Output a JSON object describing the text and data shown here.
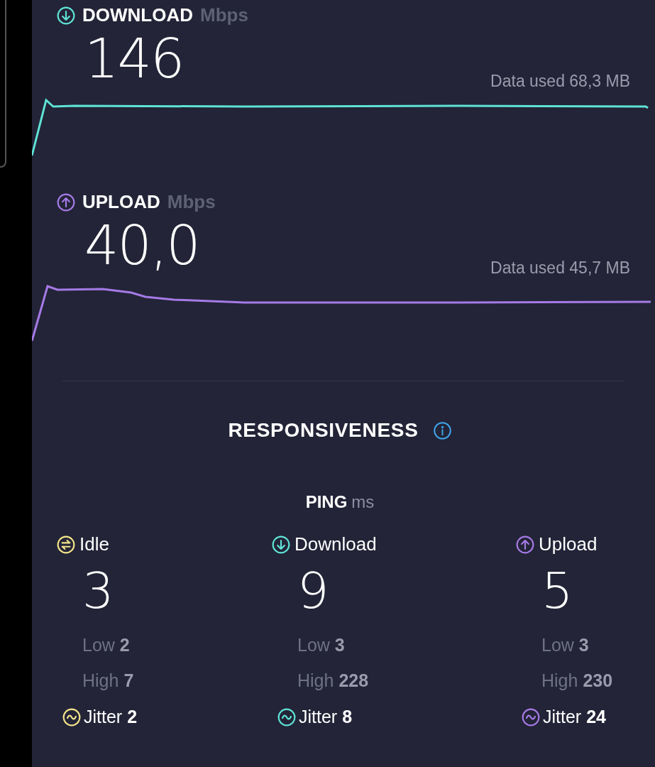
{
  "speeds": [
    {
      "kind": "download",
      "label": "DOWNLOAD",
      "unit": "Mbps",
      "value": "146",
      "data_used": "Data used 68,3 MB",
      "color": "#5fe3d6"
    },
    {
      "kind": "upload",
      "label": "UPLOAD",
      "unit": "Mbps",
      "value": "40,0",
      "data_used": "Data used 45,7 MB",
      "color": "#a57ae6"
    }
  ],
  "responsiveness": {
    "title": "RESPONSIVENESS",
    "ping_label": "PING",
    "ping_unit": "ms",
    "columns": [
      {
        "kind": "idle",
        "label": "Idle",
        "value": "3",
        "low": "Low **2**",
        "high": "High **7**",
        "jitter": "Jitter **2**",
        "color": "#f2e48a"
      },
      {
        "kind": "download",
        "label": "Download",
        "value": "9",
        "low": "Low **3**",
        "high": "High **228**",
        "jitter": "Jitter **8**",
        "color": "#5fe3d6"
      },
      {
        "kind": "upload",
        "label": "Upload",
        "value": "5",
        "low": "Low **3**",
        "high": "High **230**",
        "jitter": "Jitter **24**",
        "color": "#a57ae6"
      }
    ]
  }
}
